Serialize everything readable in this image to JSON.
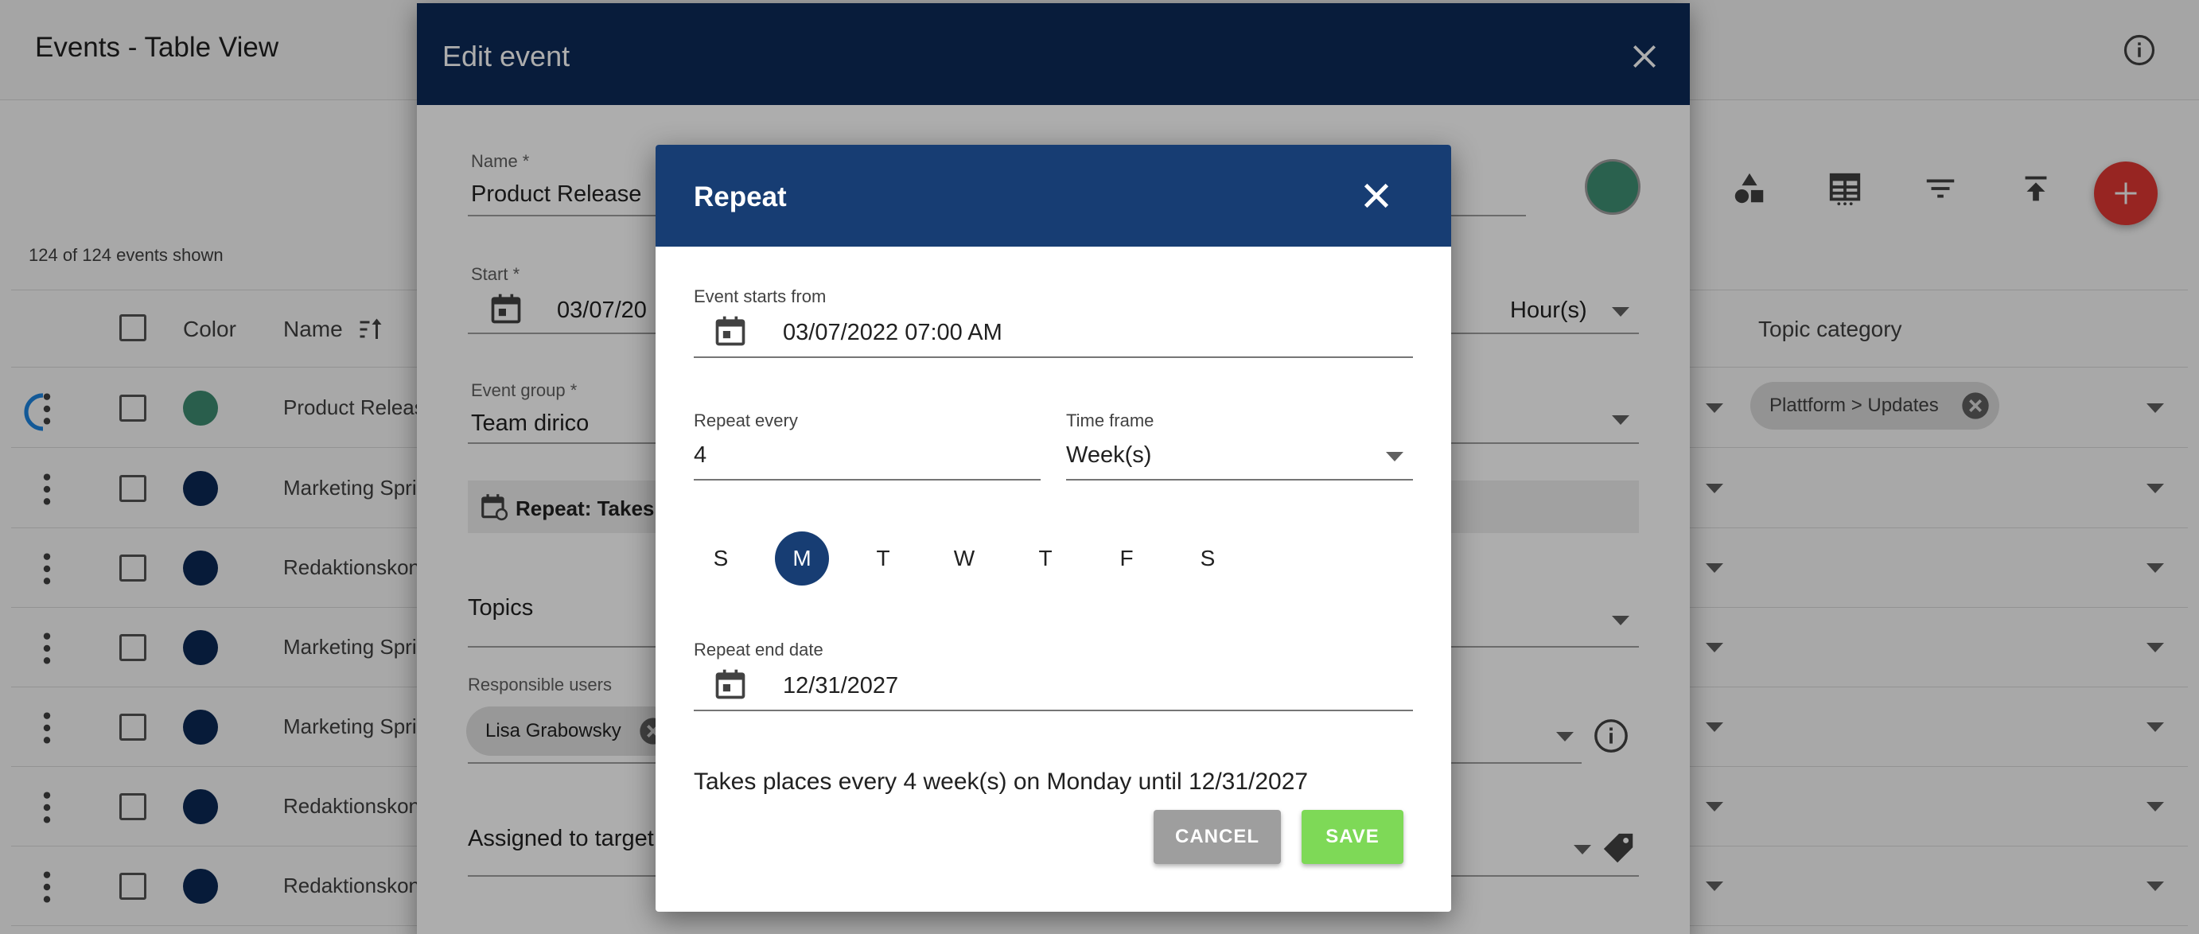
{
  "page": {
    "title": "Events - Table View",
    "events_count": "124 of 124 events shown"
  },
  "table": {
    "columns": {
      "color": "Color",
      "name": "Name",
      "topic_category": "Topic category"
    },
    "rows": [
      {
        "name": "Product Releas",
        "color": "#3f8f74",
        "topic": "Plattform > Updates"
      },
      {
        "name": "Marketing Sprin",
        "color": "#0c2a57"
      },
      {
        "name": "Redaktionskon",
        "color": "#0c2a57"
      },
      {
        "name": "Marketing Sprin",
        "color": "#0c2a57"
      },
      {
        "name": "Marketing Sprin",
        "color": "#0c2a57"
      },
      {
        "name": "Redaktionskon",
        "color": "#0c2a57"
      },
      {
        "name": "Redaktionskon",
        "color": "#0c2a57"
      }
    ]
  },
  "edit_event": {
    "title": "Edit event",
    "name_label": "Name *",
    "name_value": "Product Release",
    "start_label": "Start *",
    "start_value": "03/07/20",
    "duration_unit": "Hour(s)",
    "event_group_label": "Event group *",
    "event_group_value": "Team dirico",
    "repeat_summary": "Repeat: Takes p",
    "topics_label": "Topics",
    "responsible_label": "Responsible users",
    "responsible_user": "Lisa Grabowsky",
    "assigned_label": "Assigned to target"
  },
  "repeat": {
    "title": "Repeat",
    "starts_label": "Event starts from",
    "starts_value": "03/07/2022 07:00 AM",
    "every_label": "Repeat every",
    "every_value": "4",
    "timeframe_label": "Time frame",
    "timeframe_value": "Week(s)",
    "days": [
      "S",
      "M",
      "T",
      "W",
      "T",
      "F",
      "S"
    ],
    "active_day_index": 1,
    "end_label": "Repeat end date",
    "end_value": "12/31/2027",
    "summary": "Takes places every 4 week(s) on Monday until 12/31/2027",
    "cancel_label": "CANCEL",
    "save_label": "SAVE"
  },
  "colors": {
    "header_navy": "#0c2a57",
    "repeat_header": "#173d73",
    "save_green": "#7ed957",
    "fab_red": "#e53935",
    "event_green": "#3f8f74"
  },
  "icons": [
    "info-icon",
    "shapes-icon",
    "table-icon",
    "filter-icon",
    "export-icon",
    "plus-icon",
    "close-icon",
    "calendar-icon",
    "calendar-sync-icon",
    "chevron-down-icon",
    "kebab-icon",
    "tag-icon",
    "sort-icon"
  ]
}
